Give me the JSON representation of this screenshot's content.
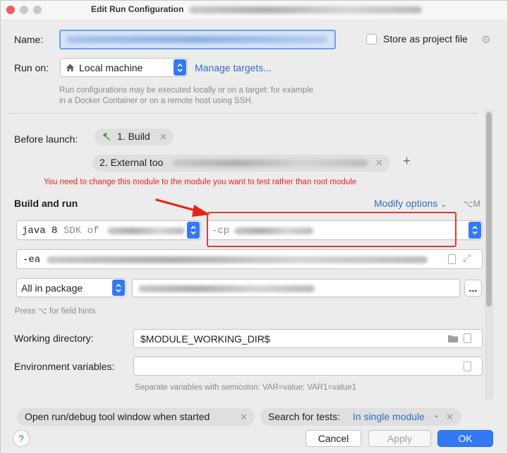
{
  "window": {
    "title": "Edit Run Configuration",
    "colors": {
      "close": "#ee5e55",
      "minimize": "#c9c9c9",
      "zoom": "#c9c9c9",
      "accent": "#3478f6"
    }
  },
  "name_row": {
    "label": "Name:",
    "store_label": "Store as project file"
  },
  "run_on": {
    "label": "Run on:",
    "value": "Local machine",
    "manage_link": "Manage targets...",
    "hint": [
      "Run configurations may be executed locally or on a target: for example",
      "in a Docker Container or on a remote host using SSH."
    ]
  },
  "before_launch": {
    "label": "Before launch:",
    "tasks": [
      {
        "label": "1. Build"
      },
      {
        "label": "2. External too"
      }
    ]
  },
  "annotation": {
    "text": "You need to change this module to the module you want to test rather than root module",
    "color": "#e8231e"
  },
  "build_and_run": {
    "heading": "Build and run",
    "modify_options": "Modify options",
    "modify_shortcut": "⌥M",
    "jdk_prefix": "java 8",
    "jdk_suffix": "SDK of",
    "cp_prefix": "-cp",
    "vm_options_prefix": "-ea",
    "test_kind": "All in package",
    "field_hint": "Press ⌥ for field hints",
    "more_button": "..."
  },
  "working_dir": {
    "label": "Working directory:",
    "value": "$MODULE_WORKING_DIR$"
  },
  "env": {
    "label": "Environment variables:",
    "hint": "Separate variables with semicolon: VAR=value; VAR1=value1"
  },
  "bottom_chips": {
    "open_tool_window": "Open run/debug tool window when started",
    "search_prefix": "Search for tests:",
    "search_value": "In single module"
  },
  "footer": {
    "help": "?",
    "cancel": "Cancel",
    "apply": "Apply",
    "ok": "OK"
  }
}
